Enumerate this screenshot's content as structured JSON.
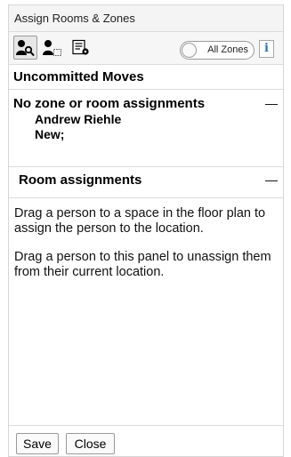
{
  "panel": {
    "title": "Assign Rooms & Zones"
  },
  "toolbar": {
    "tools": [
      {
        "icon": "person-search-icon"
      },
      {
        "icon": "person-room-icon"
      },
      {
        "icon": "list-settings-icon"
      }
    ],
    "toggle_label": "All Zones",
    "toggle_on": false,
    "info_label": "i"
  },
  "moves": {
    "heading": "Uncommitted Moves",
    "no_assignment": {
      "heading": "No zone or room assignments",
      "collapse_label": "—",
      "people": [
        {
          "name": "Andrew Riehle",
          "status": "New;"
        }
      ]
    },
    "room_assignments": {
      "heading": "Room assignments",
      "collapse_label": "—"
    }
  },
  "instructions": {
    "assign": "Drag a person to a space in the floor plan to assign the person to the location.",
    "unassign": "Drag a person to this panel to unassign them from their current location."
  },
  "footer": {
    "save_label": "Save",
    "close_label": "Close"
  }
}
